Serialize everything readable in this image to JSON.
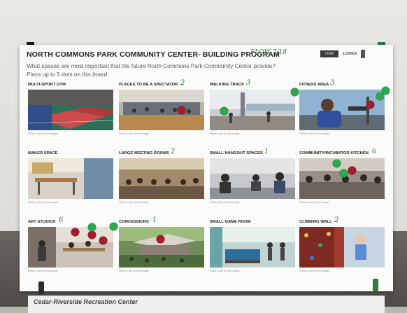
{
  "board": {
    "title": "NORTH COMMONS PARK COMMUNITY CENTER- BUILDING PROGRAM",
    "handwritten_note": "FLOW 7/18",
    "question": "What spaces are most important that the future North Commons Park Community Center provide?",
    "instruction": "Place up to 5 dots on this board",
    "logos": [
      "HGA",
      "LOOKS"
    ]
  },
  "spaces": [
    {
      "label": "MULTI-SPORT GYM",
      "votes": "",
      "caption": "Place a dot on this image",
      "green_dots": 0,
      "red_dots": 0
    },
    {
      "label": "PLACES TO BE A SPECTATOR",
      "votes": "2",
      "caption": "Place a dot on this image",
      "green_dots": 0,
      "red_dots": 1
    },
    {
      "label": "WALKING TRACK",
      "votes": "3",
      "caption": "Place a dot on this image",
      "green_dots": 1,
      "red_dots": 0
    },
    {
      "label": "FITNESS AREA",
      "votes": "3",
      "caption": "Place a dot on this image",
      "green_dots": 2,
      "red_dots": 1
    },
    {
      "label": "MAKER SPACE",
      "votes": "",
      "caption": "Place a dot on this image",
      "green_dots": 0,
      "red_dots": 0
    },
    {
      "label": "LARGE MEETING ROOMS",
      "votes": "2",
      "caption": "Place a dot on this image",
      "green_dots": 0,
      "red_dots": 0
    },
    {
      "label": "SMALL HANGOUT SPACES",
      "votes": "1",
      "caption": "Place a dot on this image",
      "green_dots": 0,
      "red_dots": 0
    },
    {
      "label": "COMMUNITY/INCUBATOR KITCHEN",
      "votes": "6",
      "caption": "Place a dot on this image",
      "green_dots": 2,
      "red_dots": 1
    },
    {
      "label": "ART STUDIOS",
      "votes": "6",
      "caption": "Place a dot on this image",
      "green_dots": 2,
      "red_dots": 3
    },
    {
      "label": "CONCESSIONS",
      "votes": "1",
      "caption": "Place a dot on this image",
      "green_dots": 0,
      "red_dots": 1
    },
    {
      "label": "SMALL GAME ROOM",
      "votes": "",
      "caption": "Place a dot on this image",
      "green_dots": 0,
      "red_dots": 0
    },
    {
      "label": "CLIMBING WALL",
      "votes": "2",
      "caption": "Place a dot on this image",
      "green_dots": 0,
      "red_dots": 0
    }
  ],
  "sign": {
    "text": "Cedar-Riverside Recreation Center"
  },
  "colors": {
    "dot_green": "#2fa84f",
    "dot_red": "#a51d2d",
    "handwriting": "#2a7d3f"
  }
}
